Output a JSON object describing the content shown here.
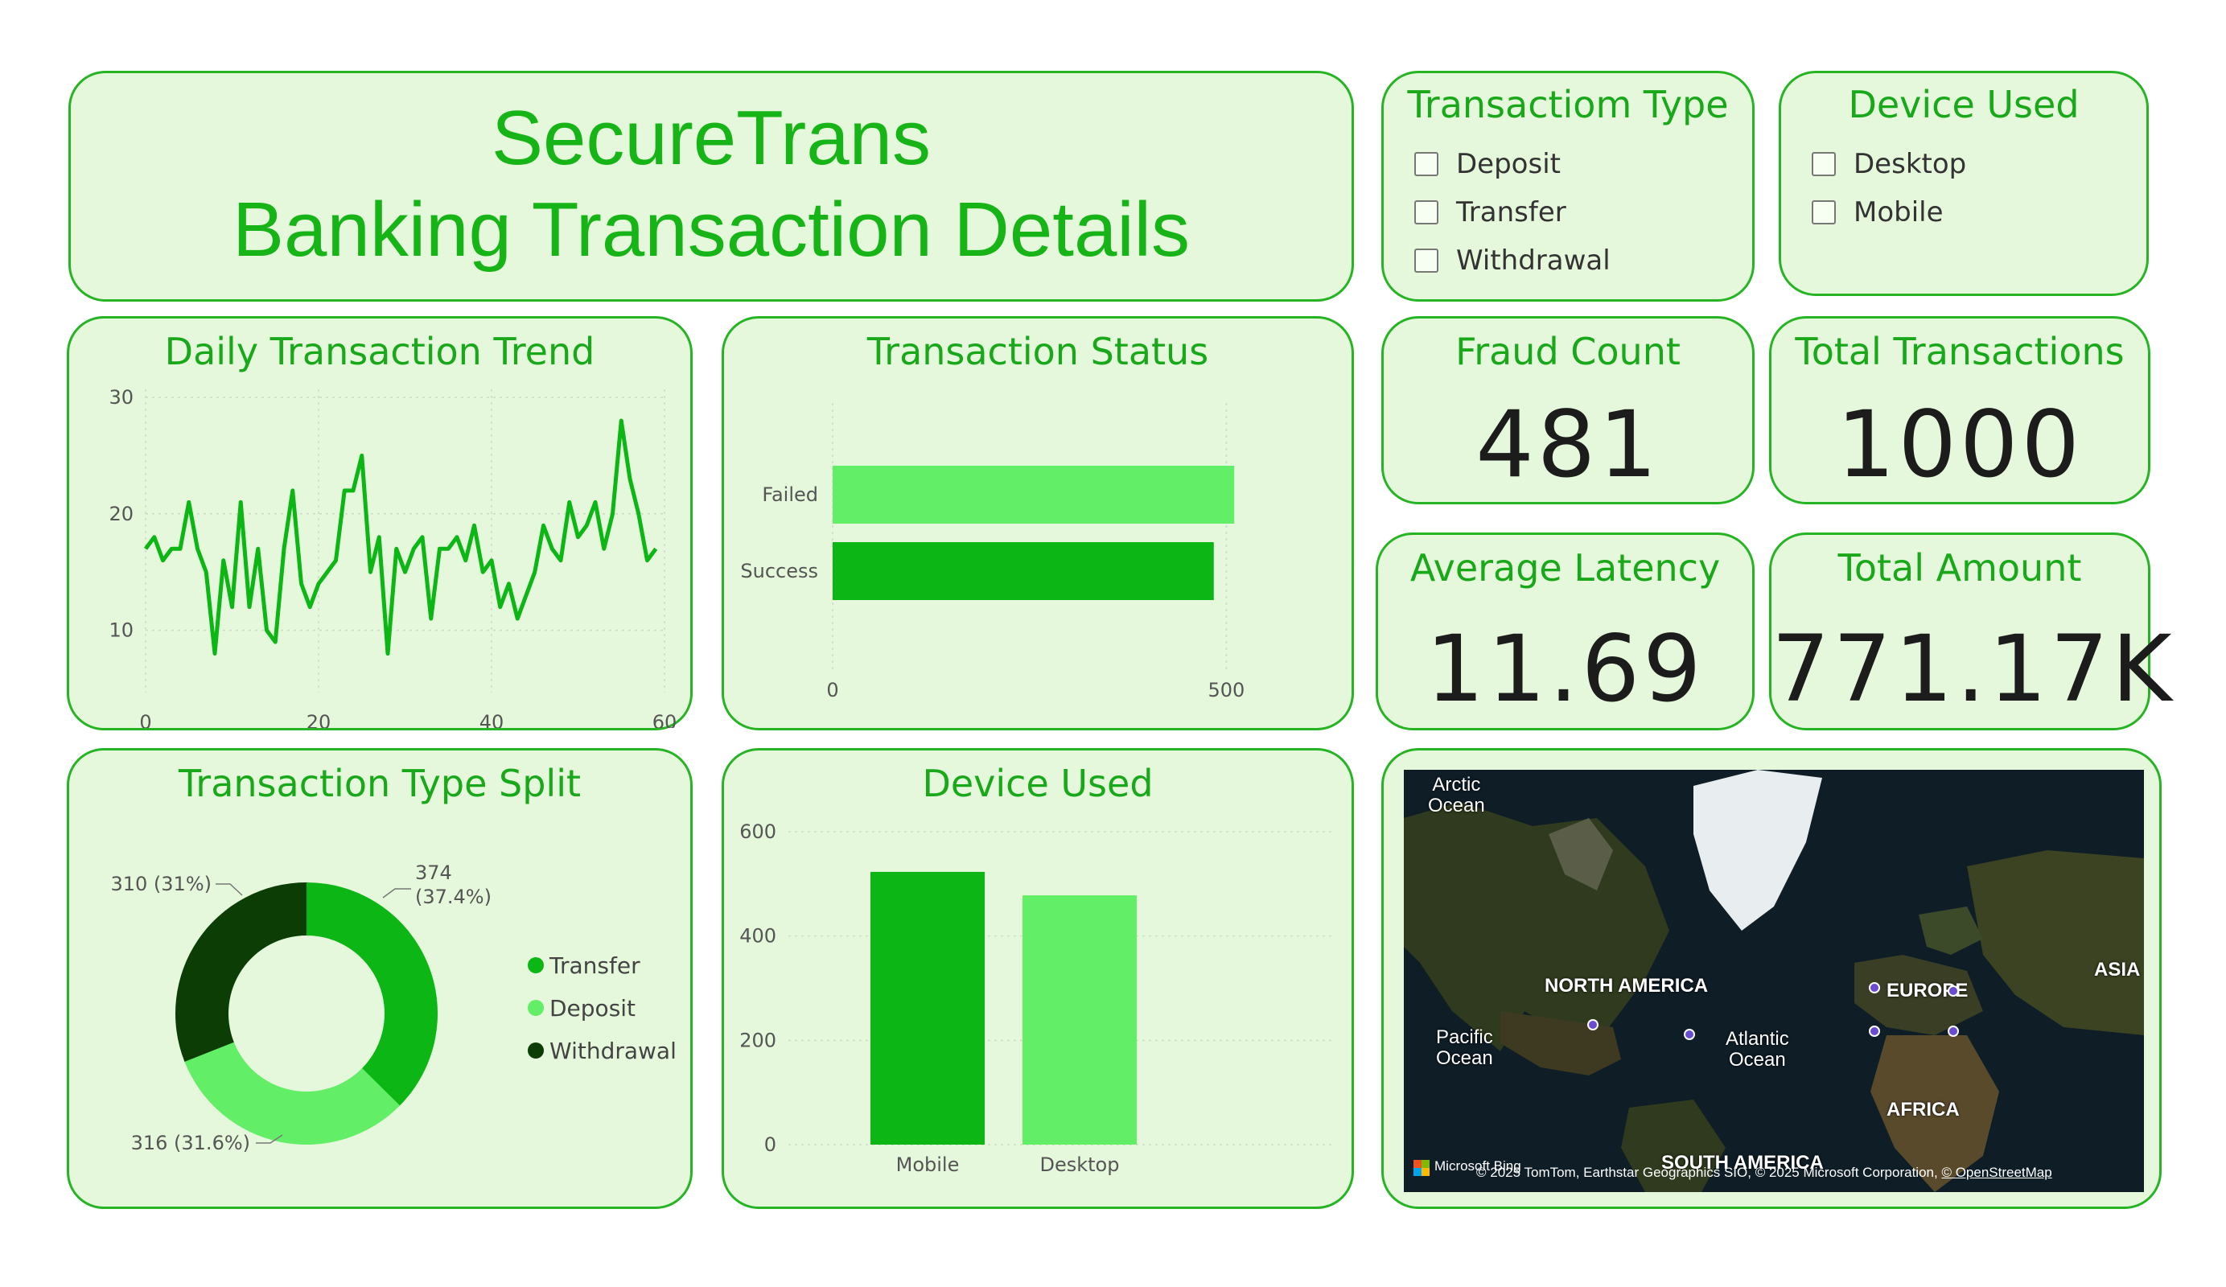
{
  "header": {
    "line1": "SecureTrans",
    "line2": "Banking Transaction Details"
  },
  "slicers": {
    "transaction_type": {
      "title": "Transactiom Type",
      "options": [
        "Deposit",
        "Transfer",
        "Withdrawal"
      ]
    },
    "device_used": {
      "title": "Device Used",
      "options": [
        "Desktop",
        "Mobile"
      ]
    }
  },
  "kpis": {
    "fraud_count": {
      "title": "Fraud Count",
      "value": "481"
    },
    "total_transactions": {
      "title": "Total Transactions",
      "value": "1000"
    },
    "average_latency": {
      "title": "Average Latency",
      "value": "11.69"
    },
    "total_amount": {
      "title": "Total Amount",
      "value": "771.17K"
    }
  },
  "charts": {
    "daily_trend": {
      "title": "Daily Transaction Trend"
    },
    "status": {
      "title": "Transaction Status"
    },
    "type_split": {
      "title": "Transaction Type Split"
    },
    "device": {
      "title": "Device Used"
    }
  },
  "map": {
    "labels": {
      "arctic": "Arctic\nOcean",
      "north_america": "NORTH AMERICA",
      "europe": "EUROPE",
      "asia": "ASIA",
      "pacific": "Pacific\nOcean",
      "atlantic": "Atlantic\nOcean",
      "africa": "AFRICA",
      "south_america": "SOUTH AMERICA"
    },
    "brand": "Microsoft Bing",
    "attribution": "© 2025 TomTom, Earthstar Geographics SIO, © 2025 Microsoft Corporation,",
    "osm_link": "© OpenStreetMap"
  },
  "colors": {
    "accent": "#19a81a",
    "card_bg": "#e6f8dc",
    "card_border": "#26b424",
    "dark_green": "#0b3d05",
    "mid_green": "#0cb614",
    "light_green": "#62ee66"
  },
  "chart_data": [
    {
      "type": "line",
      "title": "Daily Transaction Trend",
      "x": [
        0,
        1,
        2,
        3,
        4,
        5,
        6,
        7,
        8,
        9,
        10,
        11,
        12,
        13,
        14,
        15,
        16,
        17,
        18,
        19,
        20,
        21,
        22,
        23,
        24,
        25,
        26,
        27,
        28,
        29,
        30,
        31,
        32,
        33,
        34,
        35,
        36,
        37,
        38,
        39,
        40,
        41,
        42,
        43,
        44,
        45,
        46,
        47,
        48,
        49,
        50,
        51,
        52,
        53,
        54,
        55,
        56,
        57,
        58,
        59
      ],
      "series": [
        {
          "values": [
            17,
            18,
            16,
            17,
            17,
            21,
            17,
            15,
            8,
            16,
            12,
            21,
            12,
            17,
            10,
            9,
            17,
            22,
            14,
            12,
            14,
            15,
            16,
            22,
            22,
            25,
            15,
            18,
            8,
            17,
            15,
            17,
            18,
            11,
            17,
            17,
            18,
            16,
            19,
            15,
            16,
            12,
            14,
            11,
            13,
            15,
            19,
            17,
            16,
            21,
            18,
            19,
            21,
            17,
            20,
            28,
            23,
            20,
            16,
            17
          ]
        }
      ],
      "xlim": [
        0,
        60
      ],
      "ylim": [
        5,
        30
      ],
      "x_ticks": [
        0,
        20,
        40,
        60
      ],
      "y_ticks": [
        10,
        20,
        30
      ],
      "grid": true
    },
    {
      "type": "bar",
      "orientation": "horizontal",
      "title": "Transaction Status",
      "categories": [
        "Failed",
        "Success"
      ],
      "values": [
        510,
        484
      ],
      "xlim": [
        0,
        520
      ],
      "x_ticks": [
        0,
        500
      ]
    },
    {
      "type": "pie",
      "donut": true,
      "title": "Transaction Type Split",
      "categories": [
        "Transfer",
        "Deposit",
        "Withdrawal"
      ],
      "values": [
        374,
        316,
        310
      ],
      "data_labels": [
        "374\n(37.4%)",
        "316 (31.6%)",
        "310 (31%)"
      ],
      "legend": "right"
    },
    {
      "type": "bar",
      "title": "Device Used",
      "categories": [
        "Mobile",
        "Desktop"
      ],
      "values": [
        523,
        478
      ],
      "ylim": [
        0,
        600
      ],
      "y_ticks": [
        0,
        200,
        400,
        600
      ],
      "grid": true
    }
  ]
}
